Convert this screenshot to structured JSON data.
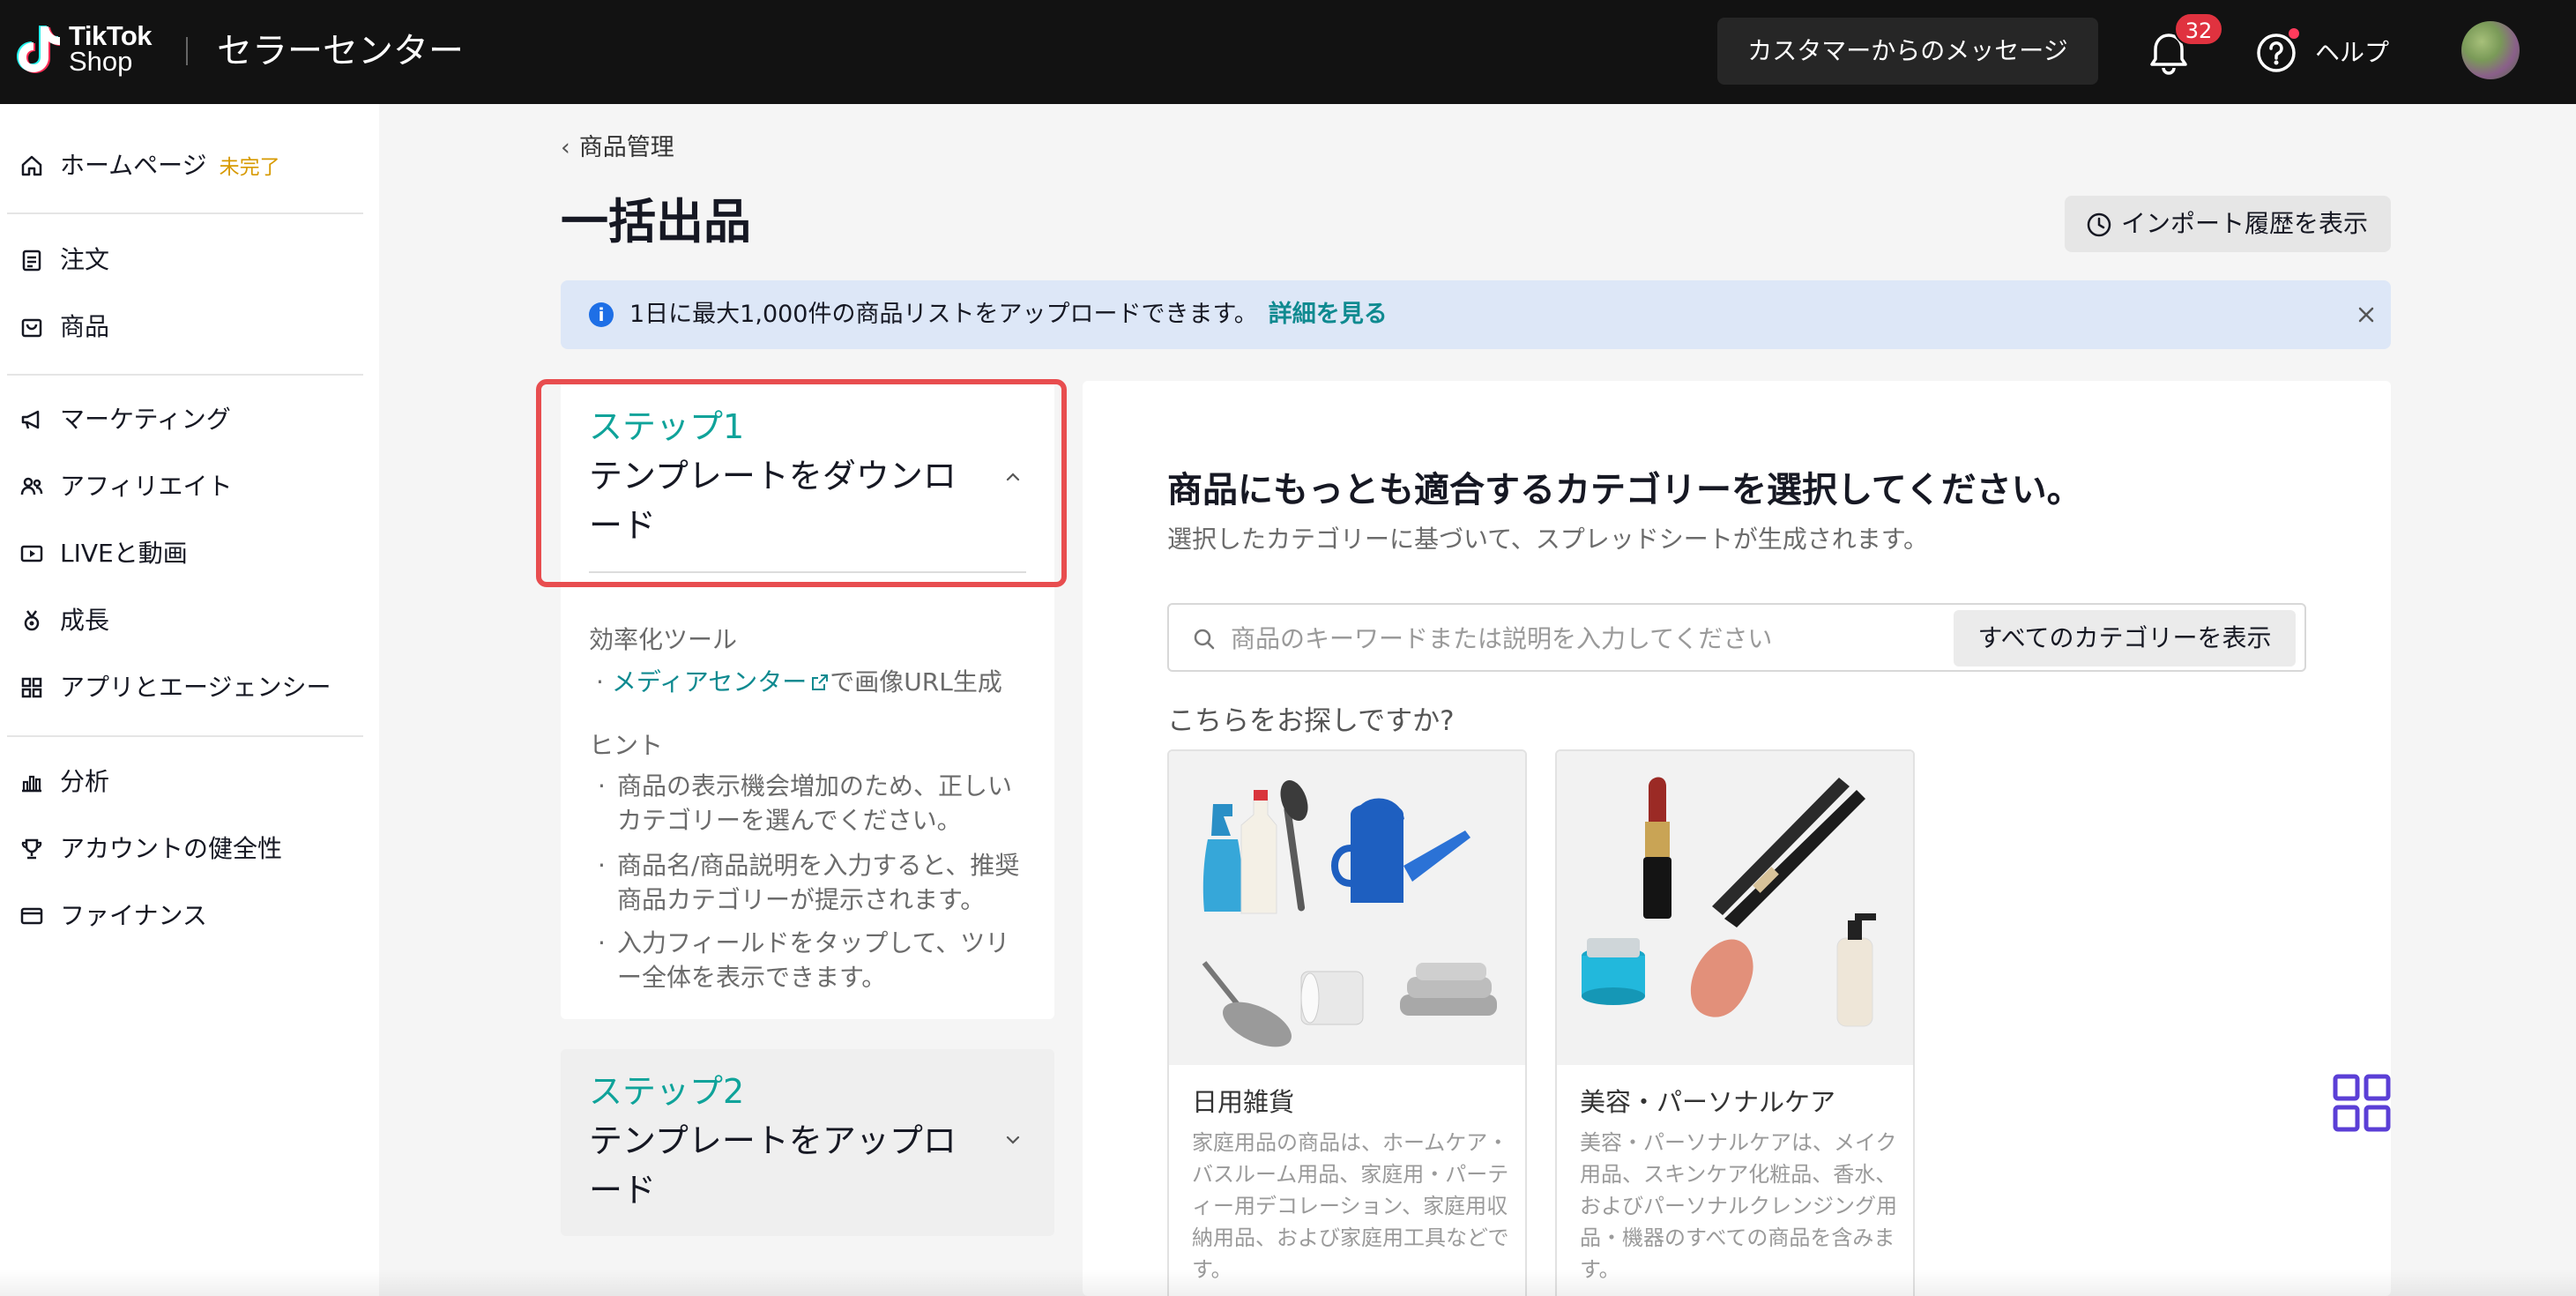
{
  "header": {
    "logo_line1": "TikTok",
    "logo_line2": "Shop",
    "app_title": "セラーセンター",
    "messages_button": "カスタマーからのメッセージ",
    "notification_count": "32",
    "help_label": "ヘルプ"
  },
  "sidebar": {
    "items": [
      {
        "label": "ホームページ",
        "badge": "未完了",
        "icon": "home-icon"
      },
      {
        "label": "注文",
        "icon": "clipboard-icon"
      },
      {
        "label": "商品",
        "icon": "bag-icon"
      },
      {
        "label": "マーケティング",
        "icon": "megaphone-icon"
      },
      {
        "label": "アフィリエイト",
        "icon": "people-icon"
      },
      {
        "label": "LIVEと動画",
        "icon": "video-icon"
      },
      {
        "label": "成長",
        "icon": "medal-icon"
      },
      {
        "label": "アプリとエージェンシー",
        "icon": "apps-icon"
      },
      {
        "label": "分析",
        "icon": "bar-chart-icon"
      },
      {
        "label": "アカウントの健全性",
        "icon": "trophy-icon"
      },
      {
        "label": "ファイナンス",
        "icon": "card-icon"
      }
    ]
  },
  "main": {
    "breadcrumb": "商品管理",
    "title": "一括出品",
    "import_history_button": "インポート履歴を表示",
    "banner": {
      "message": "1日に最大1,000件の商品リストをアップロードできます。",
      "link": "詳細を見る"
    },
    "step1": {
      "label": "ステップ1",
      "title": "テンプレートをダウンロード",
      "tools_heading": "効率化ツール",
      "tool_link": "メディアセンター",
      "tool_suffix": "で画像URL生成",
      "hint_heading": "ヒント",
      "hints": [
        "商品の表示機会増加のため、正しいカテゴリーを選んでください。",
        "商品名/商品説明を入力すると、推奨商品カテゴリーが提示されます。",
        "入力フィールドをタップして、ツリー全体を表示できます。"
      ]
    },
    "step2": {
      "label": "ステップ2",
      "title": "テンプレートをアップロード"
    },
    "panel": {
      "heading": "商品にもっとも適合するカテゴリーを選択してください。",
      "subheading": "選択したカテゴリーに基づいて、スプレッドシートが生成されます。",
      "search_placeholder": "商品のキーワードまたは説明を入力してください",
      "all_categories_button": "すべてのカテゴリーを表示",
      "suggest_heading": "こちらをお探しですか?",
      "categories": [
        {
          "name": "日用雑貨",
          "description": "家庭用品の商品は、ホームケア・バスルーム用品、家庭用・パーティー用デコレーション、家庭用収納用品、および家庭用工具などです。"
        },
        {
          "name": "美容・パーソナルケア",
          "description": "美容・パーソナルケアは、メイク用品、スキンケア化粧品、香水、およびパーソナルクレンジング用品・機器のすべての商品を含みます。"
        }
      ]
    }
  },
  "colors": {
    "accent_teal": "#0fa39a",
    "link_teal": "#0f8a90",
    "highlight_red": "#e84d4f",
    "badge_red": "#e0323f",
    "banner_bg": "#dde7f7",
    "incomplete_badge": "#d79a00"
  }
}
